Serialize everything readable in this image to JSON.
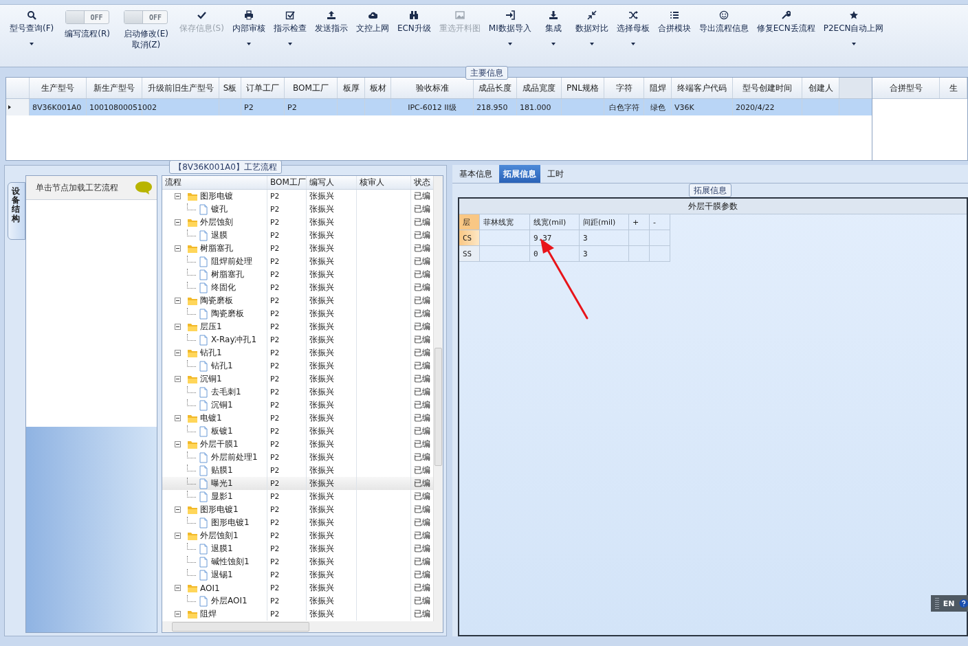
{
  "toolbar": [
    {
      "kind": "button",
      "label": "型号查询(F)",
      "dropdown": true,
      "disabled": false
    },
    {
      "kind": "toggle",
      "toggle_text": "OFF",
      "on": false,
      "label": "编写流程(R)"
    },
    {
      "kind": "toggle",
      "toggle_text": "OFF",
      "on": false,
      "label": "启动修改(E)",
      "label_2": "取消(Z)"
    },
    {
      "kind": "button",
      "label": "保存信息(S)",
      "dropdown": false,
      "disabled": true
    },
    {
      "kind": "button",
      "label": "内部审核",
      "dropdown": true,
      "disabled": false
    },
    {
      "kind": "button",
      "label": "指示检查",
      "dropdown": true,
      "disabled": false
    },
    {
      "kind": "button",
      "label": "发送指示",
      "dropdown": false,
      "disabled": false
    },
    {
      "kind": "button",
      "label": "文控上网",
      "dropdown": false,
      "disabled": false
    },
    {
      "kind": "button",
      "label": "ECN升级",
      "dropdown": false,
      "disabled": false
    },
    {
      "kind": "button",
      "label": "重选开料图",
      "dropdown": false,
      "disabled": true
    },
    {
      "kind": "button",
      "label": "MI数据导入",
      "dropdown": true,
      "disabled": false
    },
    {
      "kind": "button",
      "label": "集成",
      "dropdown": true,
      "disabled": false
    },
    {
      "kind": "button",
      "label": "数据对比",
      "dropdown": true,
      "disabled": false
    },
    {
      "kind": "button",
      "label": "选择母板",
      "dropdown": true,
      "disabled": false
    },
    {
      "kind": "button",
      "label": "合拼模块",
      "dropdown": false,
      "disabled": false
    },
    {
      "kind": "button",
      "label": "导出流程信息",
      "dropdown": false,
      "disabled": false
    },
    {
      "kind": "button",
      "label": "修复ECN丢流程",
      "dropdown": false,
      "disabled": false
    },
    {
      "kind": "button",
      "label": "P2ECN自动上网",
      "dropdown": true,
      "disabled": false
    }
  ],
  "main_info": {
    "title": "主要信息",
    "columns": [
      "生产型号",
      "新生产型号",
      "升级前旧生产型号",
      "S板",
      "订单工厂",
      "BOM工厂",
      "板厚",
      "板材",
      "验收标准",
      "成品长度",
      "成品宽度",
      "PNL规格",
      "字符",
      "阻焊",
      "终端客户代码",
      "型号创建时间",
      "创建人"
    ],
    "rows": [
      {
        "selected": true,
        "cells": [
          "8V36K001A0",
          "10010800051002",
          "",
          "",
          "P2",
          "P2",
          "",
          "",
          "IPC-6012 II级",
          "218.950",
          "181.000",
          "",
          "白色字符",
          "绿色",
          "V36K",
          "2020/4/22",
          ""
        ]
      }
    ],
    "side_columns": [
      "合拼型号",
      "生"
    ]
  },
  "process_panel": {
    "title": "【8V36K001A0】工艺流程",
    "side_tab": "设备结构",
    "hint": "单击节点加载工艺流程",
    "columns": [
      "流程",
      "BOM工厂",
      "编写人",
      "核审人",
      "状态"
    ],
    "tree": [
      {
        "name": "图形电镀",
        "bom": "P2",
        "writer": "张振兴",
        "status": "已编",
        "expanded": true,
        "selected": false,
        "children": [
          {
            "name": "镀孔",
            "bom": "P2",
            "writer": "张振兴",
            "status": "已编",
            "selected": false
          }
        ]
      },
      {
        "name": "外层蚀刻",
        "bom": "P2",
        "writer": "张振兴",
        "status": "已编",
        "expanded": true,
        "selected": false,
        "children": [
          {
            "name": "退膜",
            "bom": "P2",
            "writer": "张振兴",
            "status": "已编",
            "selected": false
          }
        ]
      },
      {
        "name": "树脂塞孔",
        "bom": "P2",
        "writer": "张振兴",
        "status": "已编",
        "expanded": true,
        "selected": false,
        "children": [
          {
            "name": "阻焊前处理",
            "bom": "P2",
            "writer": "张振兴",
            "status": "已编",
            "selected": false
          },
          {
            "name": "树脂塞孔",
            "bom": "P2",
            "writer": "张振兴",
            "status": "已编",
            "selected": false
          },
          {
            "name": "终固化",
            "bom": "P2",
            "writer": "张振兴",
            "status": "已编",
            "selected": false
          }
        ]
      },
      {
        "name": "陶瓷磨板",
        "bom": "P2",
        "writer": "张振兴",
        "status": "已编",
        "expanded": true,
        "selected": false,
        "children": [
          {
            "name": "陶瓷磨板",
            "bom": "P2",
            "writer": "张振兴",
            "status": "已编",
            "selected": false
          }
        ]
      },
      {
        "name": "层压1",
        "bom": "P2",
        "writer": "张振兴",
        "status": "已编",
        "expanded": true,
        "selected": false,
        "children": [
          {
            "name": "X-Ray冲孔1",
            "bom": "P2",
            "writer": "张振兴",
            "status": "已编",
            "selected": false
          }
        ]
      },
      {
        "name": "钻孔1",
        "bom": "P2",
        "writer": "张振兴",
        "status": "已编",
        "expanded": true,
        "selected": false,
        "children": [
          {
            "name": "钻孔1",
            "bom": "P2",
            "writer": "张振兴",
            "status": "已编",
            "selected": false
          }
        ]
      },
      {
        "name": "沉铜1",
        "bom": "P2",
        "writer": "张振兴",
        "status": "已编",
        "expanded": true,
        "selected": false,
        "children": [
          {
            "name": "去毛刺1",
            "bom": "P2",
            "writer": "张振兴",
            "status": "已编",
            "selected": false
          },
          {
            "name": "沉铜1",
            "bom": "P2",
            "writer": "张振兴",
            "status": "已编",
            "selected": false
          }
        ]
      },
      {
        "name": "电镀1",
        "bom": "P2",
        "writer": "张振兴",
        "status": "已编",
        "expanded": true,
        "selected": false,
        "children": [
          {
            "name": "板镀1",
            "bom": "P2",
            "writer": "张振兴",
            "status": "已编",
            "selected": false
          }
        ]
      },
      {
        "name": "外层干膜1",
        "bom": "P2",
        "writer": "张振兴",
        "status": "已编",
        "expanded": true,
        "selected": false,
        "children": [
          {
            "name": "外层前处理1",
            "bom": "P2",
            "writer": "张振兴",
            "status": "已编",
            "selected": false
          },
          {
            "name": "贴膜1",
            "bom": "P2",
            "writer": "张振兴",
            "status": "已编",
            "selected": false
          },
          {
            "name": "曝光1",
            "bom": "P2",
            "writer": "张振兴",
            "status": "已编",
            "selected": true
          },
          {
            "name": "显影1",
            "bom": "P2",
            "writer": "张振兴",
            "status": "已编",
            "selected": false
          }
        ]
      },
      {
        "name": "图形电镀1",
        "bom": "P2",
        "writer": "张振兴",
        "status": "已编",
        "expanded": true,
        "selected": false,
        "children": [
          {
            "name": "图形电镀1",
            "bom": "P2",
            "writer": "张振兴",
            "status": "已编",
            "selected": false
          }
        ]
      },
      {
        "name": "外层蚀刻1",
        "bom": "P2",
        "writer": "张振兴",
        "status": "已编",
        "expanded": true,
        "selected": false,
        "children": [
          {
            "name": "退膜1",
            "bom": "P2",
            "writer": "张振兴",
            "status": "已编",
            "selected": false
          },
          {
            "name": "碱性蚀刻1",
            "bom": "P2",
            "writer": "张振兴",
            "status": "已编",
            "selected": false
          },
          {
            "name": "退锡1",
            "bom": "P2",
            "writer": "张振兴",
            "status": "已编",
            "selected": false
          }
        ]
      },
      {
        "name": "AOI1",
        "bom": "P2",
        "writer": "张振兴",
        "status": "已编",
        "expanded": true,
        "selected": false,
        "children": [
          {
            "name": "外层AOI1",
            "bom": "P2",
            "writer": "张振兴",
            "status": "已编",
            "selected": false
          }
        ]
      },
      {
        "name": "阻焊",
        "bom": "P2",
        "writer": "张振兴",
        "status": "已编",
        "expanded": true,
        "selected": false
      }
    ]
  },
  "detail_panel": {
    "tabs": [
      {
        "label": "基本信息",
        "selected": false
      },
      {
        "label": "拓展信息",
        "selected": true
      },
      {
        "label": "工时",
        "selected": false
      }
    ],
    "group_title": "拓展信息",
    "table_title": "外层干膜参数",
    "columns": [
      "层",
      "菲林线宽",
      "线宽(mil)",
      "间距(mil)",
      "+",
      "-"
    ],
    "rows": [
      {
        "selected": true,
        "cells": [
          "CS",
          "",
          "9.37",
          "3",
          "",
          ""
        ]
      },
      {
        "selected": false,
        "cells": [
          "SS",
          "",
          "0",
          "3",
          "",
          ""
        ]
      }
    ]
  },
  "language_badge": "EN"
}
